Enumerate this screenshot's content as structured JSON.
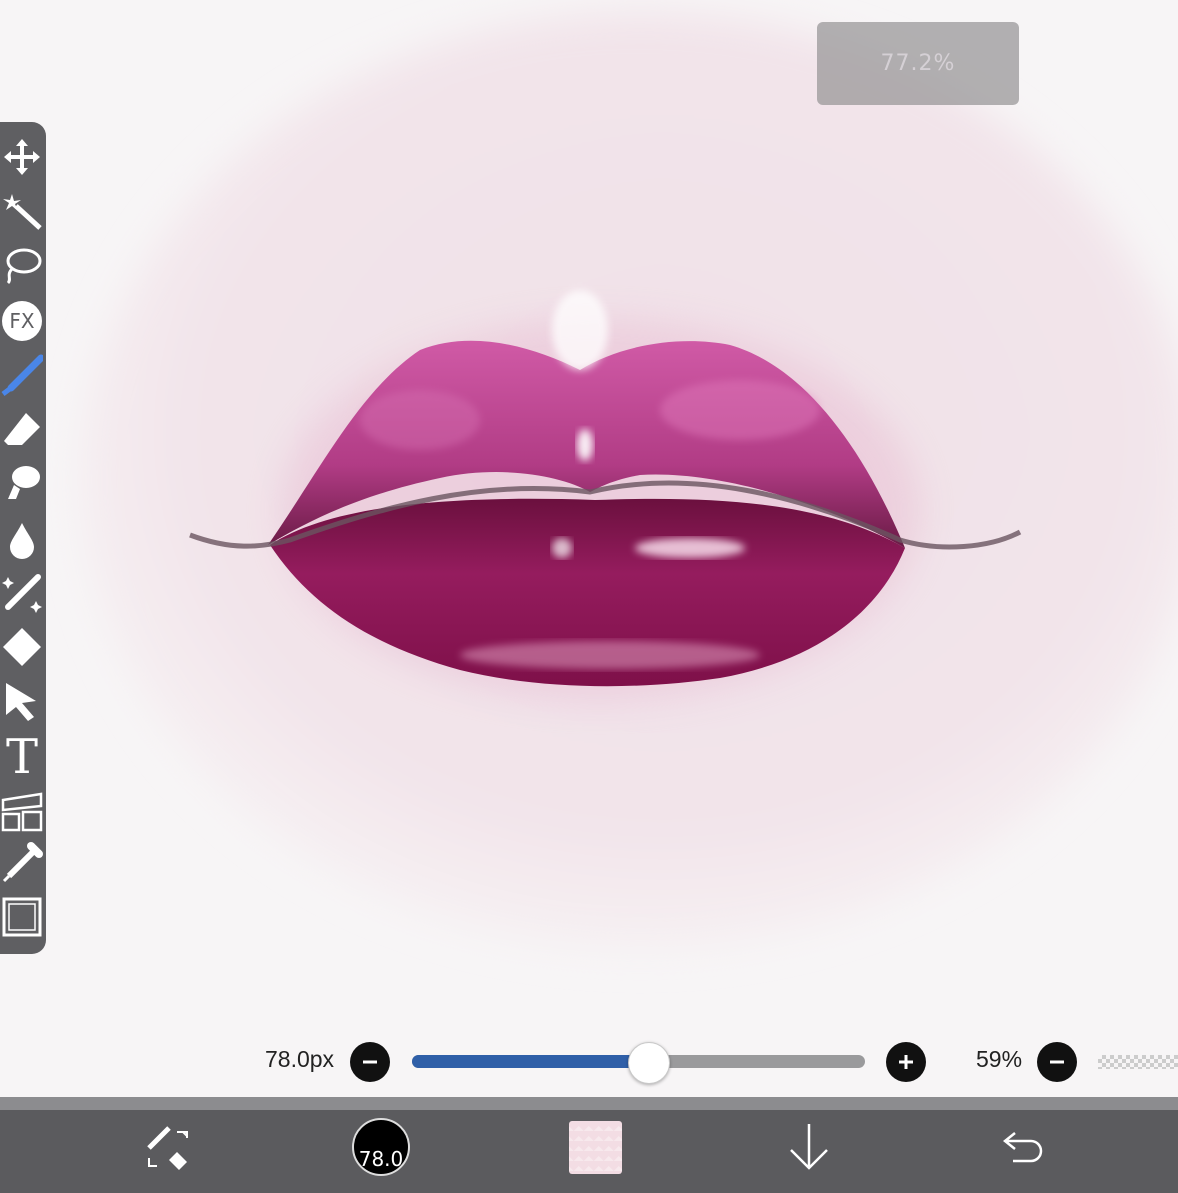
{
  "zoom": {
    "label": "77.2%"
  },
  "toolbar": {
    "tools": [
      {
        "name": "move-icon"
      },
      {
        "name": "magic-wand-icon"
      },
      {
        "name": "lasso-icon"
      },
      {
        "name": "fx-icon",
        "label": "FX"
      },
      {
        "name": "brush-icon",
        "active": true
      },
      {
        "name": "eraser-icon"
      },
      {
        "name": "smudge-icon"
      },
      {
        "name": "blur-icon"
      },
      {
        "name": "special-brush-icon"
      },
      {
        "name": "fill-icon"
      },
      {
        "name": "select-icon"
      },
      {
        "name": "text-icon",
        "label": "T"
      },
      {
        "name": "frame-divider-icon"
      },
      {
        "name": "eyedropper-icon"
      },
      {
        "name": "canvas-icon"
      }
    ]
  },
  "brush": {
    "size_label": "78.0px",
    "size_fraction": 0.52,
    "opacity_label": "59%"
  },
  "bottom_bar": {
    "brush_size_label": "78.0",
    "color": "#f3dde4",
    "items": [
      "brush-eraser-swap-icon",
      "brush-size-indicator",
      "color-swatch",
      "layer-down-icon",
      "undo-icon"
    ]
  },
  "colors": {
    "accent": "#2f5fa8",
    "toolbar_bg": "#5f5f62",
    "bottom_bar_bg": "#5b5b5e",
    "lip_color": "#9b1a5c"
  }
}
